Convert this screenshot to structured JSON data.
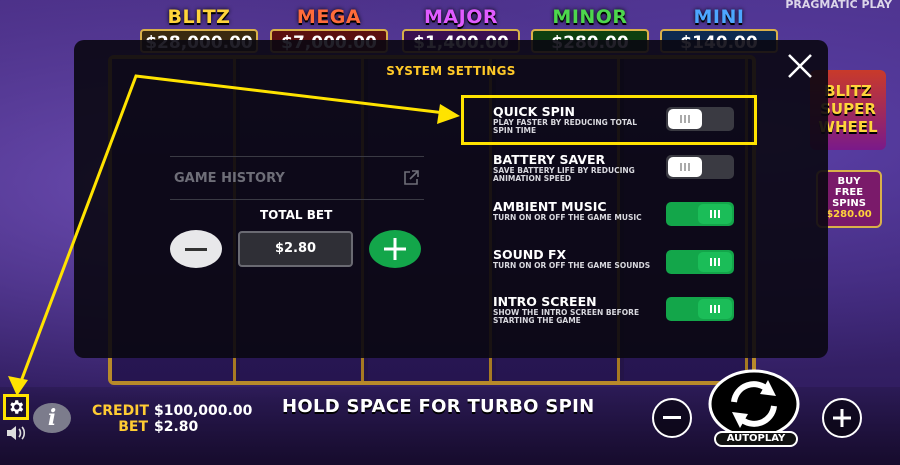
{
  "brand": "PRAGMATIC PLAY",
  "jackpots": [
    {
      "name": "BLITZ",
      "amount": "$28,000.00",
      "color": "#ffd43b",
      "box": "#3a2a10"
    },
    {
      "name": "MEGA",
      "amount": "$7,000.00",
      "color": "#ff6b3a",
      "box": "#5a1010"
    },
    {
      "name": "MAJOR",
      "amount": "$1,400.00",
      "color": "#e05bff",
      "box": "#3a1050"
    },
    {
      "name": "MINOR",
      "amount": "$280.00",
      "color": "#4dd64d",
      "box": "#0e4010"
    },
    {
      "name": "MINI",
      "amount": "$140.00",
      "color": "#4da6ff",
      "box": "#0e2a50"
    }
  ],
  "side": {
    "logo": "BLITZ SUPER WHEEL",
    "buy_line1": "BUY",
    "buy_line2": "FREE",
    "buy_line3": "SPINS",
    "buy_price": "$280.00"
  },
  "modal": {
    "title": "SYSTEM SETTINGS",
    "game_history": "GAME HISTORY",
    "total_bet_label": "TOTAL BET",
    "total_bet_value": "$2.80",
    "settings": [
      {
        "title": "QUICK SPIN",
        "desc": "PLAY FASTER BY REDUCING TOTAL SPIN TIME",
        "on": false
      },
      {
        "title": "BATTERY SAVER",
        "desc": "SAVE BATTERY LIFE BY REDUCING ANIMATION SPEED",
        "on": false
      },
      {
        "title": "AMBIENT MUSIC",
        "desc": "TURN ON OR OFF THE GAME MUSIC",
        "on": true
      },
      {
        "title": "SOUND FX",
        "desc": "TURN ON OR OFF THE GAME SOUNDS",
        "on": true
      },
      {
        "title": "INTRO SCREEN",
        "desc": "SHOW THE INTRO SCREEN BEFORE STARTING THE GAME",
        "on": true
      }
    ]
  },
  "bottom": {
    "credit_label": "CREDIT",
    "credit_value": "$100,000.00",
    "bet_label": "BET",
    "bet_value": "$2.80",
    "message": "HOLD SPACE FOR TURBO SPIN",
    "autoplay": "AUTOPLAY",
    "info": "i"
  },
  "colors": {
    "highlight": "#ffe300",
    "toggle_on": "#13a64a",
    "title_gold": "#ffc928"
  }
}
